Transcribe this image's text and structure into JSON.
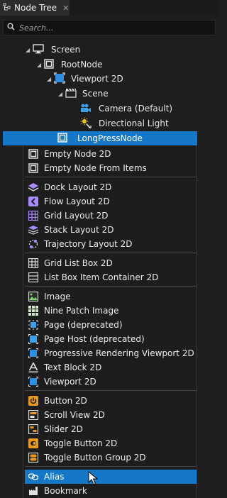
{
  "tab": {
    "title": "Node Tree",
    "close": "✕"
  },
  "search": {
    "placeholder": "Search..."
  },
  "tree": {
    "screen": "Screen",
    "root_node": "RootNode",
    "viewport": "Viewport 2D",
    "scene": "Scene",
    "camera": "Camera (Default)",
    "light": "Directional Light",
    "selected": "LongPressNode"
  },
  "menu": {
    "group1": [
      "Empty Node 2D",
      "Empty Node From Items"
    ],
    "group2": [
      "Dock Layout 2D",
      "Flow Layout 2D",
      "Grid Layout 2D",
      "Stack Layout 2D",
      "Trajectory Layout 2D"
    ],
    "group3": [
      "Grid List Box 2D",
      "List Box Item Container 2D"
    ],
    "group4": [
      "Image",
      "Nine Patch Image",
      "Page (deprecated)",
      "Page Host (deprecated)",
      "Progressive Rendering Viewport 2D",
      "Text Block 2D",
      "Viewport 2D"
    ],
    "group5": [
      "Button 2D",
      "Scroll View 2D",
      "Slider 2D",
      "Toggle Button 2D",
      "Toggle Button Group 2D"
    ],
    "group6": [
      "Alias",
      "Bookmark"
    ]
  },
  "colors": {
    "accent": "#1577c7",
    "background": "#1d1d1d",
    "orange": "#e89a1f",
    "purple": "#a98bff"
  }
}
